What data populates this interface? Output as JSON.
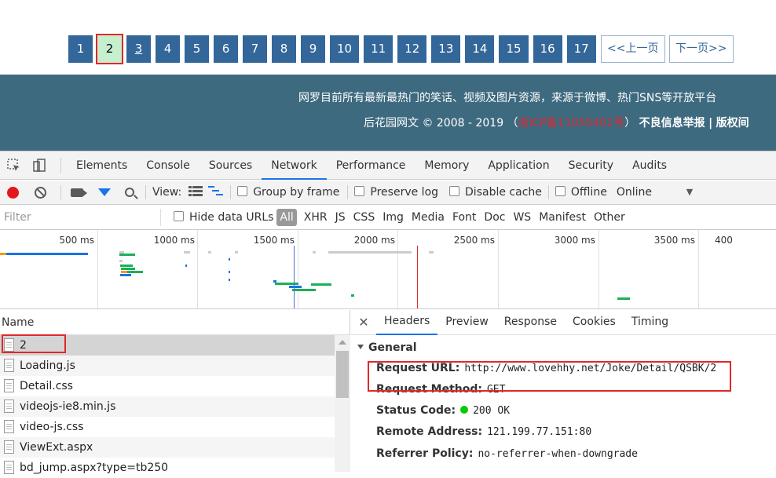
{
  "pagination": {
    "pages": [
      "1",
      "2",
      "3",
      "4",
      "5",
      "6",
      "7",
      "8",
      "9",
      "10",
      "11",
      "12",
      "13",
      "14",
      "15",
      "16",
      "17"
    ],
    "current": "2",
    "prev_label": "<<上一页",
    "next_label": "下一页>>"
  },
  "footer": {
    "line1": "网罗目前所有最新最热门的笑话、视频及图片资源，来源于微博、热门SNS等开放平台",
    "line2_prefix": "后花园网文 © 2008 - 2019 （",
    "icp": "浙ICP备11055401号",
    "line2_suffix": "）",
    "report": "不良信息举报",
    "sep": "|",
    "copyright": "版权间"
  },
  "devtools": {
    "tabs": [
      "Elements",
      "Console",
      "Sources",
      "Network",
      "Performance",
      "Memory",
      "Application",
      "Security",
      "Audits"
    ],
    "active_tab": "Network",
    "toolbar": {
      "view_label": "View:",
      "group_by_frame": "Group by frame",
      "preserve_log": "Preserve log",
      "disable_cache": "Disable cache",
      "offline": "Offline",
      "online": "Online"
    },
    "filter": {
      "placeholder": "Filter",
      "hide_data_urls": "Hide data URLs",
      "types": [
        "All",
        "XHR",
        "JS",
        "CSS",
        "Img",
        "Media",
        "Font",
        "Doc",
        "WS",
        "Manifest",
        "Other"
      ]
    },
    "timeline": {
      "ticks": [
        "500 ms",
        "1000 ms",
        "1500 ms",
        "2000 ms",
        "2500 ms",
        "3000 ms",
        "3500 ms",
        "400"
      ]
    },
    "requests": {
      "header": "Name",
      "rows": [
        "2",
        "Loading.js",
        "Detail.css",
        "videojs-ie8.min.js",
        "video-js.css",
        "ViewExt.aspx",
        "bd_jump.aspx?type=tb250"
      ]
    },
    "details": {
      "tabs": [
        "Headers",
        "Preview",
        "Response",
        "Cookies",
        "Timing"
      ],
      "active_tab": "Headers",
      "section": "General",
      "fields": [
        {
          "key": "Request URL:",
          "value": "http://www.lovehhy.net/Joke/Detail/QSBK/2"
        },
        {
          "key": "Request Method:",
          "value": "GET"
        },
        {
          "key": "Status Code:",
          "value": "200 OK"
        },
        {
          "key": "Remote Address:",
          "value": "121.199.77.151:80"
        },
        {
          "key": "Referrer Policy:",
          "value": "no-referrer-when-downgrade"
        }
      ]
    }
  },
  "colors": {
    "pager_bg": "#336699",
    "footer_bg": "#3e6a80",
    "highlight": "#e0282a",
    "accent": "#1a73e8"
  }
}
